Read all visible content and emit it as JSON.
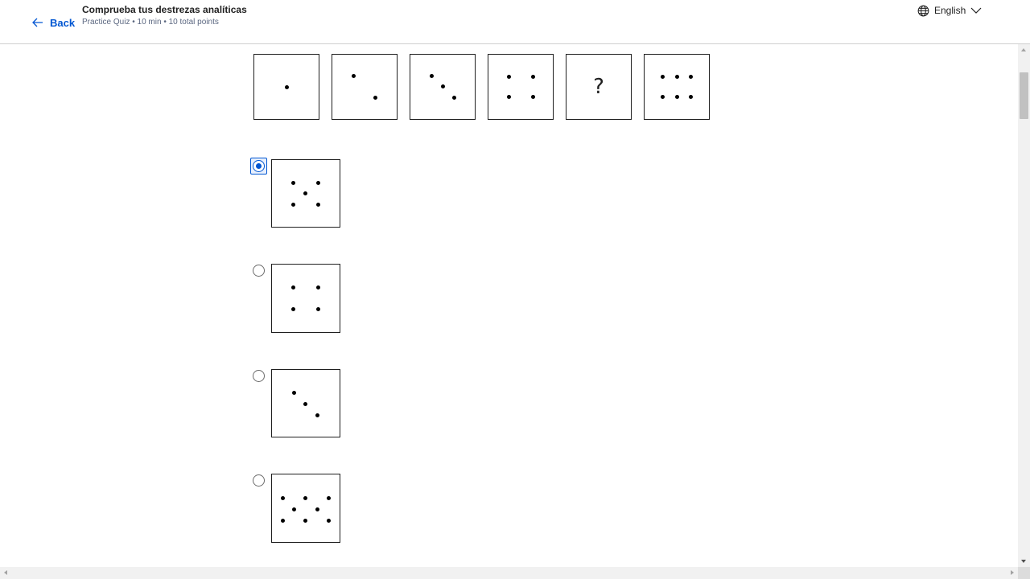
{
  "header": {
    "back_label": "Back",
    "title": "Comprueba tus destrezas analíticas",
    "subtitle": "Practice Quiz • 10 min • 10 total points",
    "language": "English"
  },
  "question": {
    "sequence": [
      {
        "dots": 1
      },
      {
        "dots": 2
      },
      {
        "dots": 3
      },
      {
        "dots": 4
      },
      {
        "unknown": "?"
      },
      {
        "dots": 6
      }
    ]
  },
  "options": [
    {
      "dots": 5,
      "selected": true
    },
    {
      "dots": 4,
      "selected": false
    },
    {
      "dots": 3,
      "selected": false
    },
    {
      "dots": 8,
      "selected": false
    }
  ],
  "colors": {
    "accent": "#0056d2",
    "text": "#1f1f1f",
    "border": "#1f1f1f",
    "muted": "#5b6780"
  }
}
